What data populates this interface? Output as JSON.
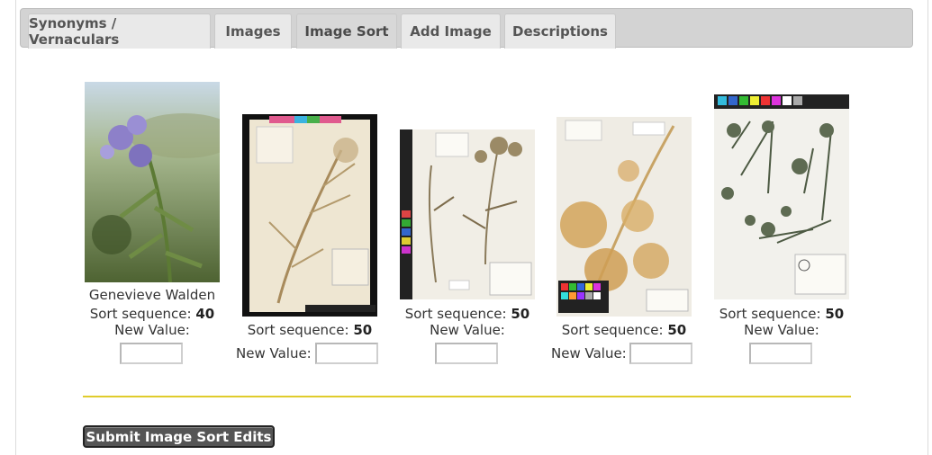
{
  "tabs": [
    {
      "label": "Synonyms / Vernaculars"
    },
    {
      "label": "Images"
    },
    {
      "label": "Image Sort"
    },
    {
      "label": "Add Image"
    },
    {
      "label": "Descriptions"
    }
  ],
  "active_tab": "Image Sort",
  "images": [
    {
      "photographer": "Genevieve Walden",
      "sort_label": "Sort sequence:",
      "sort_value": "40",
      "new_value_label": "New Value:",
      "new_value": "",
      "kind": "photo"
    },
    {
      "photographer": "",
      "sort_label": "Sort sequence:",
      "sort_value": "50",
      "new_value_label": "New Value:",
      "new_value": "",
      "kind": "herbarium-sheet"
    },
    {
      "photographer": "",
      "sort_label": "Sort sequence:",
      "sort_value": "50",
      "new_value_label": "New Value:",
      "new_value": "",
      "kind": "herbarium-sheet"
    },
    {
      "photographer": "",
      "sort_label": "Sort sequence:",
      "sort_value": "50",
      "new_value_label": "New Value:",
      "new_value": "",
      "kind": "herbarium-sheet"
    },
    {
      "photographer": "",
      "sort_label": "Sort sequence:",
      "sort_value": "50",
      "new_value_label": "New Value:",
      "new_value": "",
      "kind": "herbarium-sheet"
    }
  ],
  "submit_label": "Submit Image Sort Edits",
  "colors": {
    "divider": "#e0cc2c",
    "button_bg": "#555555",
    "tab_bg": "#e9e9e9",
    "tab_active_bg": "#d8d8d8"
  }
}
